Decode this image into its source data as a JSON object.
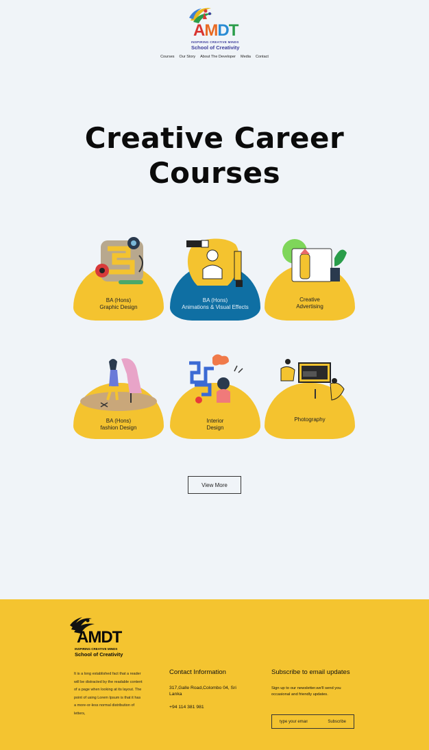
{
  "header": {
    "logo": {
      "wordmark": "AMDT",
      "tagline": "INSPIRING CREATIVE MINDS",
      "school": "School of Creativity"
    },
    "nav": [
      "Courses",
      "Our Story",
      "About The Developer",
      "Media",
      "Contact"
    ]
  },
  "hero": {
    "title_line1": "Creative Career",
    "title_line2": "Courses"
  },
  "courses": [
    {
      "line1": "BA (Hons)",
      "line2": "Graphic Design"
    },
    {
      "line1": "BA (Hons)",
      "line2": "Animations & Visual Effects"
    },
    {
      "line1": "Creative",
      "line2": "Advertising"
    },
    {
      "line1": "BA (Hons)",
      "line2": "fashion Design"
    },
    {
      "line1": "Interior",
      "line2": "Design"
    },
    {
      "line1": "Photography",
      "line2": ""
    }
  ],
  "view_more": "View More",
  "footer": {
    "logo": {
      "wordmark": "AMDT",
      "tagline": "INSPIRING CREATIVE MINDS",
      "school": "School of Creativity"
    },
    "about": "It is a long established fact that a reader will be distracted by the readable content of a page when looking at its layout. The point of using Lorem Ipsum is that it has a more-or-less normal distribution of letters,",
    "contact_heading": "Contact Information",
    "address": "317,Galle Road,Colombo 04, Sri Lanka",
    "phone": "+94 114 381 981",
    "subscribe_heading": "Subscribe to email updates",
    "subscribe_text": "Sign up to our newsletter.we'll send you occasional and friendly updates.",
    "email_placeholder": "type your email",
    "subscribe_button": "Subscribe"
  },
  "colors": {
    "background": "#f0f4f8",
    "accent_yellow": "#f4c32f",
    "accent_blue": "#0f6fa3",
    "logo_navy": "#3b3b9a"
  }
}
